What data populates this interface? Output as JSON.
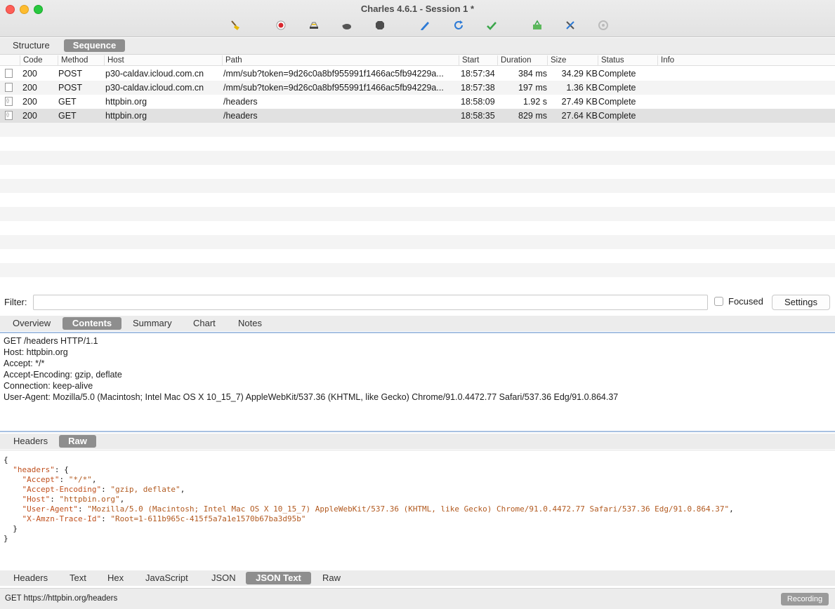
{
  "window": {
    "title": "Charles 4.6.1 - Session 1 *"
  },
  "toolbar": {
    "buttons": [
      {
        "name": "broom-icon",
        "color": "#e6a800"
      },
      {
        "name": "record-icon",
        "color": "#d9272e"
      },
      {
        "name": "throttle-icon",
        "color": "#555555"
      },
      {
        "name": "turtle-icon",
        "color": "#555555"
      },
      {
        "name": "stop-icon",
        "color": "#555555"
      },
      {
        "name": "compose-pen-icon",
        "color": "#2c7ad6"
      },
      {
        "name": "refresh-icon",
        "color": "#2c7ad6"
      },
      {
        "name": "validate-check-icon",
        "color": "#3aa64a"
      },
      {
        "name": "basket-icon",
        "color": "#3aa64a"
      },
      {
        "name": "tools-icon",
        "color": "#2c7ad6"
      },
      {
        "name": "settings-gear-icon",
        "color": "#bbbbbb"
      }
    ]
  },
  "view_tabs": {
    "structure": "Structure",
    "sequence": "Sequence",
    "active": "Sequence"
  },
  "table": {
    "columns": [
      "Code",
      "Method",
      "Host",
      "Path",
      "Start",
      "Duration",
      "Size",
      "Status",
      "Info"
    ],
    "rows": [
      {
        "code": "200",
        "method": "POST",
        "host": "p30-caldav.icloud.com.cn",
        "path": "/mm/sub?token=9d26c0a8bf955991f1466ac5fb94229a...",
        "start": "18:57:34",
        "duration": "384 ms",
        "size": "34.29 KB",
        "status": "Complete",
        "info": ""
      },
      {
        "code": "200",
        "method": "POST",
        "host": "p30-caldav.icloud.com.cn",
        "path": "/mm/sub?token=9d26c0a8bf955991f1466ac5fb94229a...",
        "start": "18:57:38",
        "duration": "197 ms",
        "size": "1.36 KB",
        "status": "Complete",
        "info": ""
      },
      {
        "code": "200",
        "method": "GET",
        "host": "httpbin.org",
        "path": "/headers",
        "start": "18:58:09",
        "duration": "1.92 s",
        "size": "27.49 KB",
        "status": "Complete",
        "info": ""
      },
      {
        "code": "200",
        "method": "GET",
        "host": "httpbin.org",
        "path": "/headers",
        "start": "18:58:35",
        "duration": "829 ms",
        "size": "27.64 KB",
        "status": "Complete",
        "info": ""
      }
    ],
    "selected_row": 3
  },
  "filter": {
    "label": "Filter:",
    "value": "",
    "focused_label": "Focused",
    "focused_checked": false,
    "settings_label": "Settings"
  },
  "detail_tabs": {
    "items": [
      "Overview",
      "Contents",
      "Summary",
      "Chart",
      "Notes"
    ],
    "active": "Contents"
  },
  "request": {
    "lines": [
      "GET /headers HTTP/1.1",
      "Host: httpbin.org",
      "Accept: */*",
      "Accept-Encoding: gzip, deflate",
      "Connection: keep-alive",
      "User-Agent: Mozilla/5.0 (Macintosh; Intel Mac OS X 10_15_7) AppleWebKit/537.36 (KHTML, like Gecko) Chrome/91.0.4472.77 Safari/537.36 Edg/91.0.864.37"
    ]
  },
  "request_tabs": {
    "items": [
      "Headers",
      "Raw"
    ],
    "active": "Raw"
  },
  "response": {
    "open_brace": "{",
    "headers_key": "\"headers\"",
    "entries": [
      {
        "key": "\"Accept\"",
        "value": "\"*/*\""
      },
      {
        "key": "\"Accept-Encoding\"",
        "value": "\"gzip, deflate\""
      },
      {
        "key": "\"Host\"",
        "value": "\"httpbin.org\""
      },
      {
        "key": "\"User-Agent\"",
        "value": "\"Mozilla/5.0 (Macintosh; Intel Mac OS X 10_15_7) AppleWebKit/537.36 (KHTML, like Gecko) Chrome/91.0.4472.77 Safari/537.36 Edg/91.0.864.37\""
      },
      {
        "key": "\"X-Amzn-Trace-Id\"",
        "value": "\"Root=1-611b965c-415f5a7a1e1570b67ba3d95b\""
      }
    ],
    "close_inner": "}",
    "close_brace": "}"
  },
  "response_tabs": {
    "items": [
      "Headers",
      "Text",
      "Hex",
      "JavaScript",
      "JSON",
      "JSON Text",
      "Raw"
    ],
    "active": "JSON Text"
  },
  "statusbar": {
    "text": "GET https://httpbin.org/headers",
    "recording_label": "Recording"
  }
}
